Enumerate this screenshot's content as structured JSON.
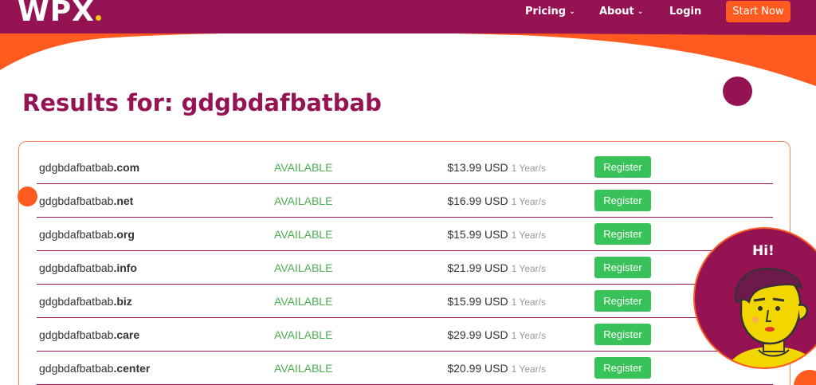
{
  "nav": {
    "logo": "WPX",
    "items": [
      {
        "label": "Pricing",
        "has_dropdown": true
      },
      {
        "label": "About",
        "has_dropdown": true
      },
      {
        "label": "Login",
        "has_dropdown": false
      }
    ],
    "cta": "Start Now"
  },
  "heading": {
    "prefix": "Results for:",
    "query": "gdgbdafbatbab"
  },
  "results": [
    {
      "name": "gdgbdafbatbab",
      "tld": ".com",
      "status": "AVAILABLE",
      "price": "$13.99 USD",
      "period": "1 Year/s",
      "action": "Register"
    },
    {
      "name": "gdgbdafbatbab",
      "tld": ".net",
      "status": "AVAILABLE",
      "price": "$16.99 USD",
      "period": "1 Year/s",
      "action": "Register"
    },
    {
      "name": "gdgbdafbatbab",
      "tld": ".org",
      "status": "AVAILABLE",
      "price": "$15.99 USD",
      "period": "1 Year/s",
      "action": "Register"
    },
    {
      "name": "gdgbdafbatbab",
      "tld": ".info",
      "status": "AVAILABLE",
      "price": "$21.99 USD",
      "period": "1 Year/s",
      "action": "Register"
    },
    {
      "name": "gdgbdafbatbab",
      "tld": ".biz",
      "status": "AVAILABLE",
      "price": "$15.99 USD",
      "period": "1 Year/s",
      "action": "Register"
    },
    {
      "name": "gdgbdafbatbab",
      "tld": ".care",
      "status": "AVAILABLE",
      "price": "$29.99 USD",
      "period": "1 Year/s",
      "action": "Register"
    },
    {
      "name": "gdgbdafbatbab",
      "tld": ".center",
      "status": "AVAILABLE",
      "price": "$20.99 USD",
      "period": "1 Year/s",
      "action": "Register"
    }
  ],
  "chat": {
    "greeting": "Hi!",
    "avatar_icon": "cartoon-support-agent-icon"
  },
  "colors": {
    "brand_purple": "#951353",
    "accent_orange": "#ff5a1f",
    "available_green": "#4caf50",
    "register_green": "#39c25a"
  }
}
